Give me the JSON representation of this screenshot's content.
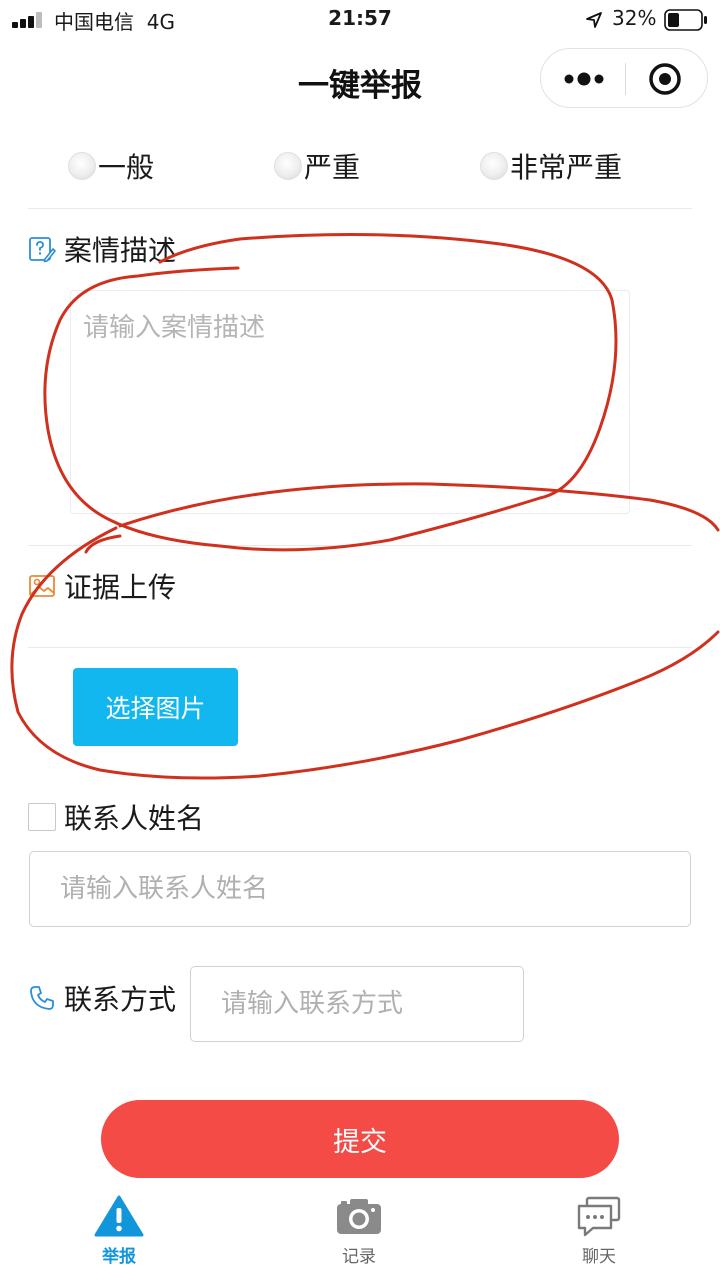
{
  "status_bar": {
    "carrier": "中国电信",
    "network": "4G",
    "time": "21:57",
    "battery": "32%"
  },
  "title_bar": {
    "title": "一键举报",
    "more_icon": "more-dots-icon",
    "close_icon": "target-circle-icon"
  },
  "severity": {
    "options": [
      "一般",
      "严重",
      "非常严重"
    ]
  },
  "description": {
    "label": "案情描述",
    "placeholder": "请输入案情描述",
    "value": ""
  },
  "evidence": {
    "label": "证据上传",
    "button": "选择图片"
  },
  "contact_name": {
    "label": "联系人姓名",
    "placeholder": "请输入联系人姓名",
    "value": ""
  },
  "contact_method": {
    "label": "联系方式",
    "placeholder": "请输入联系方式",
    "value": ""
  },
  "submit": {
    "label": "提交"
  },
  "tabs": [
    {
      "label": "举报",
      "icon": "warning-icon",
      "active": true
    },
    {
      "label": "记录",
      "icon": "camera-icon",
      "active": false
    },
    {
      "label": "聊天",
      "icon": "chat-icon",
      "active": false
    }
  ],
  "colors": {
    "accent": "#1296db",
    "upload_button": "#12b7ef",
    "submit_button": "#f54b47",
    "annotation": "#d0301e"
  }
}
